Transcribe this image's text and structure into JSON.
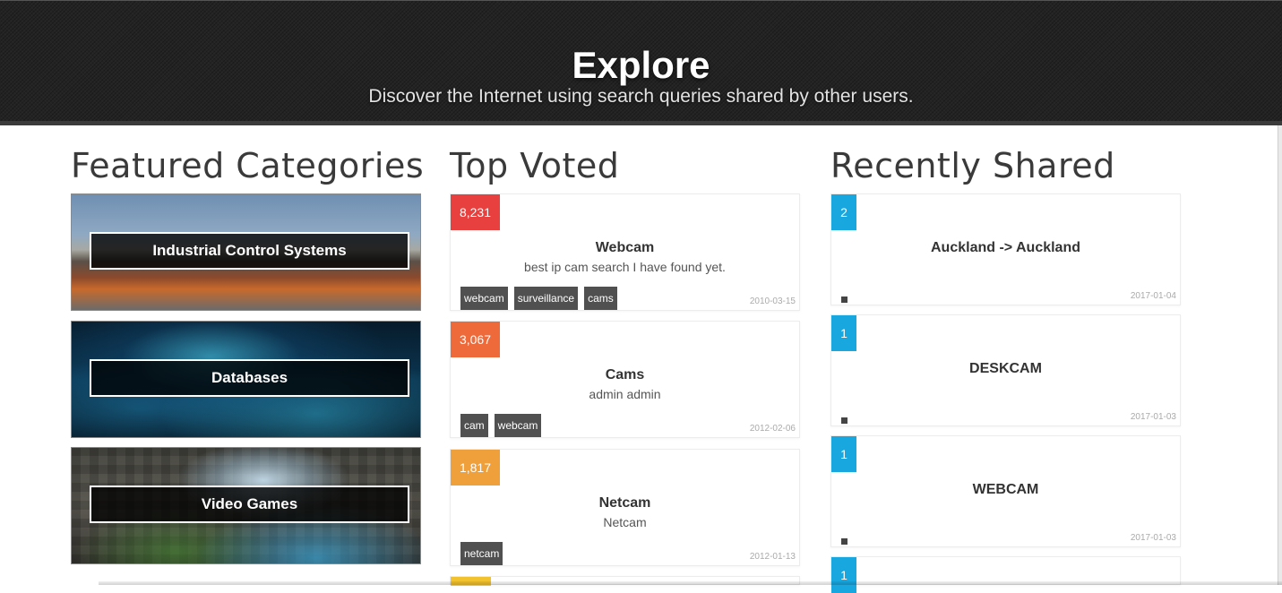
{
  "header": {
    "title": "Explore",
    "subtitle": "Discover the Internet using search queries shared by other users."
  },
  "featured": {
    "heading": "Featured Categories",
    "items": [
      {
        "label": "Industrial Control Systems"
      },
      {
        "label": "Databases"
      },
      {
        "label": "Video Games"
      }
    ]
  },
  "top_voted": {
    "heading": "Top Voted",
    "items": [
      {
        "votes": "8,231",
        "vote_color": "#e8403f",
        "title": "Webcam",
        "description": "best ip cam search I have found yet.",
        "tags": [
          "webcam",
          "surveillance",
          "cams"
        ],
        "date": "2010-03-15"
      },
      {
        "votes": "3,067",
        "vote_color": "#ee6a3a",
        "title": "Cams",
        "description": "admin admin",
        "tags": [
          "cam",
          "webcam"
        ],
        "date": "2012-02-06"
      },
      {
        "votes": "1,817",
        "vote_color": "#f0a03a",
        "title": "Netcam",
        "description": "Netcam",
        "tags": [
          "netcam"
        ],
        "date": "2012-01-13"
      },
      {
        "vote_color": "#f2c12e"
      }
    ]
  },
  "recently_shared": {
    "heading": "Recently Shared",
    "items": [
      {
        "votes": "2",
        "vote_color": "#19a7e0",
        "title": "Auckland -> Auckland",
        "date": "2017-01-04"
      },
      {
        "votes": "1",
        "vote_color": "#19a7e0",
        "title": "DESKCAM",
        "date": "2017-01-03"
      },
      {
        "votes": "1",
        "vote_color": "#19a7e0",
        "title": "WEBCAM",
        "date": "2017-01-03"
      },
      {
        "votes": "1",
        "vote_color": "#19a7e0"
      }
    ]
  }
}
